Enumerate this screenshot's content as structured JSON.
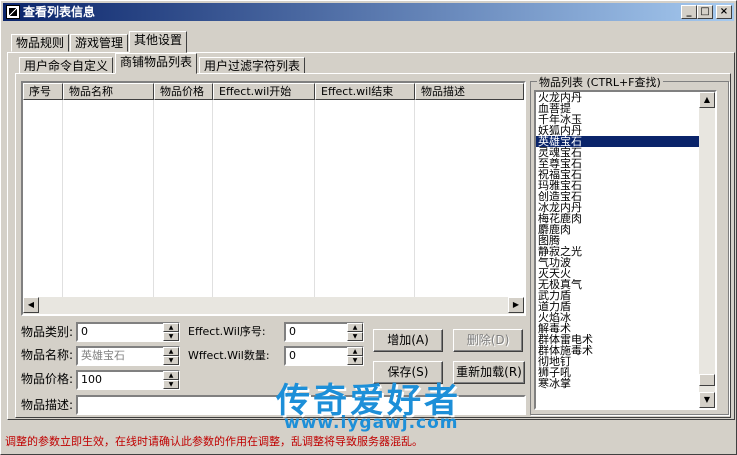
{
  "window": {
    "title": "查看列表信息",
    "min": "_",
    "max": "□",
    "close": "×"
  },
  "tabs": [
    "物品规则",
    "游戏管理",
    "其他设置"
  ],
  "subtabs": [
    "用户命令自定义",
    "商铺物品列表",
    "用户过滤字符列表"
  ],
  "table": {
    "columns": [
      "序号",
      "物品名称",
      "物品价格",
      "Effect.wil开始",
      "Effect.wil结束",
      "物品描述"
    ],
    "rows": []
  },
  "form": {
    "category_label": "物品类别:",
    "category_value": "0",
    "name_label": "物品名称:",
    "name_value": "英雄宝石",
    "price_label": "物品价格:",
    "price_value": "100",
    "desc_label": "物品描述:",
    "desc_value": "",
    "wil_index_label": "Effect.Wil序号:",
    "wil_index_value": "0",
    "wil_count_label": "Wffect.Wil数量:",
    "wil_count_value": "0"
  },
  "buttons": {
    "add": "增加(A)",
    "delete": "删除(D)",
    "save": "保存(S)",
    "reload": "重新加载(R)"
  },
  "item_list": {
    "title": "物品列表 (CTRL+F查找)",
    "selected": "英雄宝石",
    "items": [
      "火龙内丹",
      "血菩提",
      "千年冰玉",
      "妖狐内丹",
      "英雄宝石",
      "灵魂宝石",
      "至尊宝石",
      "祝福宝石",
      "玛雅宝石",
      "创造宝石",
      "冰龙内丹",
      "梅花鹿肉",
      "麝鹿肉",
      "图腾",
      "静寂之光",
      "气功波",
      "灭天火",
      "无极真气",
      "武力盾",
      "道力盾",
      "火焰冰",
      "解毒术",
      "群体雷电术",
      "群体施毒术",
      "彻地钉",
      "狮子吼",
      "寒冰掌"
    ]
  },
  "status": "调整的参数立即生效，在线时请确认此参数的作用在调整，乱调整将导致服务器混乱。",
  "watermark": {
    "title": "传奇爱好者",
    "url": "www.iygawj.com"
  }
}
